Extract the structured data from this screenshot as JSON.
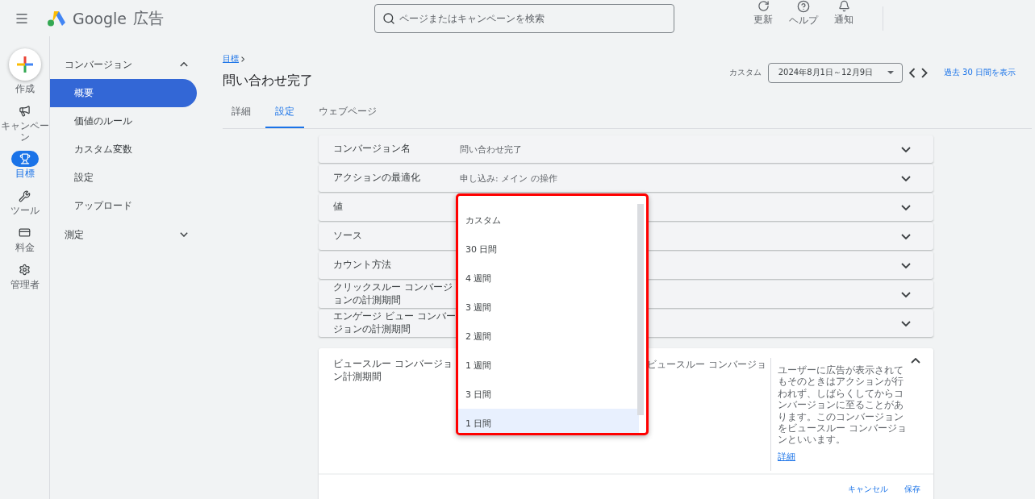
{
  "header": {
    "brand": "Google",
    "product": "広告",
    "search": {
      "placeholder": "ページまたはキャンペーンを検索"
    },
    "actions": [
      {
        "kind": "refresh",
        "label": "更新"
      },
      {
        "kind": "help",
        "label": "ヘルプ"
      },
      {
        "kind": "notify",
        "label": "通知"
      }
    ]
  },
  "rail": [
    {
      "kind": "create",
      "label": "作成",
      "selected": false
    },
    {
      "kind": "campaign",
      "label": "キャンペーン",
      "selected": false
    },
    {
      "kind": "goal",
      "label": "目標",
      "selected": true
    },
    {
      "kind": "tool",
      "label": "ツール",
      "selected": false
    },
    {
      "kind": "billing",
      "label": "料金",
      "selected": false
    },
    {
      "kind": "admin",
      "label": "管理者",
      "selected": false
    }
  ],
  "nav": [
    {
      "label": "コンバージョン",
      "expanded": true,
      "children": [
        {
          "label": "概要",
          "selected": true
        },
        {
          "label": "価値のルール",
          "selected": false
        },
        {
          "label": "カスタム変数",
          "selected": false
        },
        {
          "label": "設定",
          "selected": false
        },
        {
          "label": "アップロード",
          "selected": false
        }
      ]
    },
    {
      "label": "測定",
      "expanded": false
    }
  ],
  "page": {
    "breadcrumb": "目標",
    "title": "問い合わせ完了",
    "tabs": [
      {
        "label": "詳細",
        "selected": false
      },
      {
        "label": "設定",
        "selected": true
      },
      {
        "label": "ウェブページ",
        "selected": false
      }
    ],
    "date": {
      "label": "カスタム",
      "range": "2024年8月1日～12月9日",
      "link": "過去 30 日間を表示"
    }
  },
  "settings": [
    {
      "label": "コンバージョン名",
      "value": "問い合わせ完了"
    },
    {
      "label": "アクションの最適化",
      "value": "申し込み: メイン の操作"
    },
    {
      "label": "値"
    },
    {
      "label": "ソース"
    },
    {
      "label": "カウント方法"
    },
    {
      "label": "クリックスルー コンバージョンの計測期間"
    },
    {
      "label": "エンゲージ ビュー コンバージョンの計測期間"
    }
  ],
  "expanded": {
    "label": "ビュースルー コンバージョン計測期間",
    "value": "ビュースルー コンバージョ",
    "help": "ユーザーに広告が表示されてもそのときはアクションが行われず、しばらくしてからコンバージョンに至ることがあります。このコンバージョンをビュースルー コンバージョンといいます。",
    "help_link": "詳細",
    "buttons": [
      "キャンセル",
      "保存"
    ]
  },
  "dropdown": [
    {
      "label": "カスタム",
      "selected": false
    },
    {
      "label": "30 日間",
      "selected": false
    },
    {
      "label": "4 週間",
      "selected": false
    },
    {
      "label": "3 週間",
      "selected": false
    },
    {
      "label": "2 週間",
      "selected": false
    },
    {
      "label": "1 週間",
      "selected": false
    },
    {
      "label": "3 日間",
      "selected": false
    },
    {
      "label": "1 日間",
      "selected": true
    }
  ]
}
